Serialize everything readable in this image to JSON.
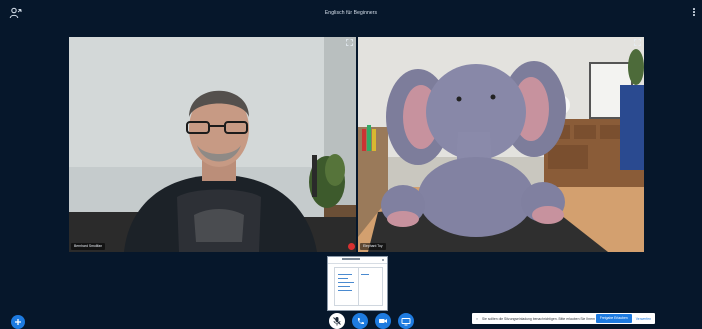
{
  "header": {
    "title": "Englisch für Beginners"
  },
  "participants": [
    {
      "name": "Bernhard Smollfan",
      "muted": true
    },
    {
      "name": "Elephant Toy"
    }
  ],
  "notification": {
    "message": "Sie sollten die Sitzungseinladung benachrichtigen. Bitte erlauben Sie Ihrem Browser Benachrichtigungen.",
    "allow_label": "Freigabe Erlauben",
    "dismiss_label": "Verwerfen"
  },
  "colors": {
    "background": "#06172b",
    "accent": "#1e7be0",
    "muted": "#d93030"
  },
  "icons": {
    "top_left": "users-icon",
    "menu": "kebab-icon",
    "add": "plus-icon",
    "mic": "microphone-off-icon",
    "phone": "phone-icon",
    "video": "video-camera-icon",
    "screen": "screen-share-icon"
  }
}
